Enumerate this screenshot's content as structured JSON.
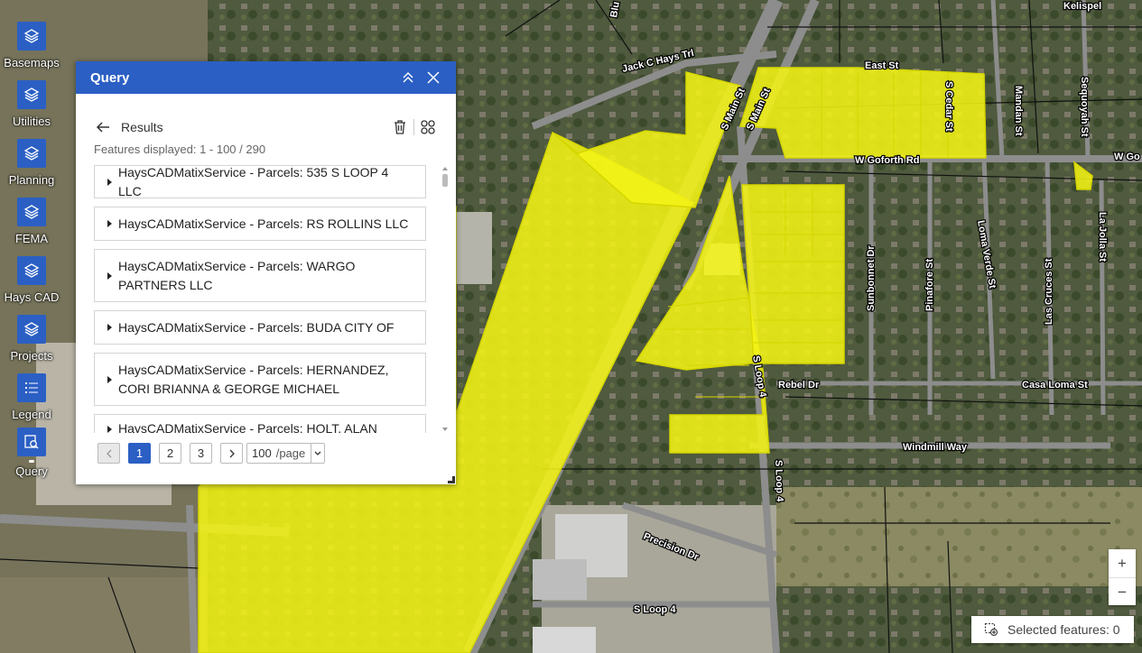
{
  "map": {
    "road_labels": [
      "Jack C Hays Trl",
      "S Main St",
      "S Main St",
      "East St",
      "S Cedar St",
      "Kelispel",
      "Mandan St",
      "Sequoyah St",
      "W Goforth Rd",
      "W Go",
      "Sunbonnet Dr",
      "Pinafore St",
      "Loma Verde St",
      "Las Cruces St",
      "La Jolla St",
      "Rebel Dr",
      "Casa Loma St",
      "Windmill Way",
      "S Loop 4",
      "S Loop 4",
      "S Loop 4",
      "Precision Dr",
      "Blu"
    ],
    "colors": {
      "highlight": "#f2f216",
      "highlight_stroke": "#d6d600"
    }
  },
  "toolbar": {
    "items": [
      {
        "label": "Basemaps",
        "icon": "layers-icon"
      },
      {
        "label": "Utilities",
        "icon": "layers-icon"
      },
      {
        "label": "Planning",
        "icon": "layers-icon"
      },
      {
        "label": "FEMA",
        "icon": "layers-icon"
      },
      {
        "label": "Hays CAD",
        "icon": "layers-icon"
      },
      {
        "label": "Projects",
        "icon": "layers-icon"
      },
      {
        "label": "Legend",
        "icon": "legend-icon"
      },
      {
        "label": "Query",
        "icon": "query-icon"
      }
    ]
  },
  "query_panel": {
    "title": "Query",
    "results_label": "Results",
    "features_displayed": "Features displayed: 1 - 100 / 290",
    "items": [
      "HaysCADMatixService - Parcels: 535 S LOOP 4 LLC",
      "HaysCADMatixService - Parcels: RS ROLLINS LLC",
      "HaysCADMatixService - Parcels: WARGO PARTNERS LLC",
      "HaysCADMatixService - Parcels: BUDA CITY OF",
      "HaysCADMatixService - Parcels: HERNANDEZ, CORI BRIANNA & GEORGE MICHAEL",
      "HaysCADMatixService - Parcels: HOLT, ALAN"
    ],
    "pagination": {
      "pages": [
        "1",
        "2",
        "3"
      ],
      "current": "1",
      "page_size": "100",
      "page_size_unit": "/page"
    },
    "colors": {
      "header": "#2b5fc4"
    }
  },
  "zoom": {
    "in": "+",
    "out": "−"
  },
  "selected_features": "Selected features: 0"
}
